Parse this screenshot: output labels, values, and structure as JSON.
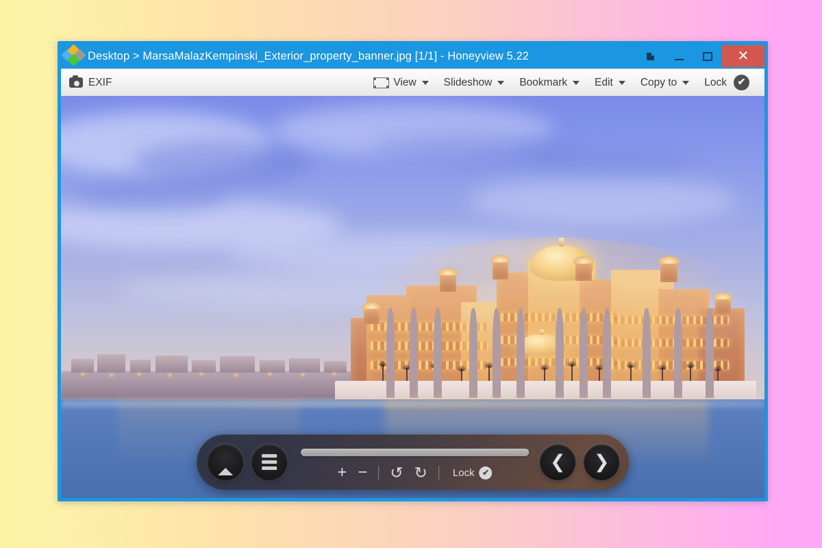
{
  "desktop": {
    "background_start": "#fcf2a4",
    "background_end": "#ffa6f8"
  },
  "window": {
    "accent_color": "#1a97e0",
    "title": "Desktop > MarsaMalazKempinski_Exterior_property_banner.jpg [1/1] - Honeyview 5.22",
    "app_name": "Honeyview",
    "app_version": "5.22",
    "breadcrumb_root": "Desktop",
    "file_name": "MarsaMalazKempinski_Exterior_property_banner.jpg",
    "index_counter": "[1/1]",
    "controls": {
      "pin": "pin",
      "minimize": "–",
      "maximize": "□",
      "close": "✕",
      "close_color": "#d4574f"
    }
  },
  "toolbar": {
    "exif_label": "EXIF",
    "view_label": "View",
    "slideshow_label": "Slideshow",
    "bookmark_label": "Bookmark",
    "edit_label": "Edit",
    "copy_to_label": "Copy to",
    "lock_label": "Lock",
    "lock_checked_glyph": "✔"
  },
  "controlbar": {
    "eject_icon": "eject-icon",
    "menu_icon": "hamburger-menu-icon",
    "zoom_in": "+",
    "zoom_out": "−",
    "rotate_ccw": "↺",
    "rotate_cw": "↻",
    "lock_label": "Lock",
    "lock_checked_glyph": "✔",
    "prev_glyph": "❮",
    "next_glyph": "❯"
  },
  "photo": {
    "subject": "Marsa Malaz Kempinski hotel exterior at dusk",
    "sky_color": "#8b9bea",
    "sea_color": "#5379b9",
    "building_glow_color": "#ffce78"
  }
}
